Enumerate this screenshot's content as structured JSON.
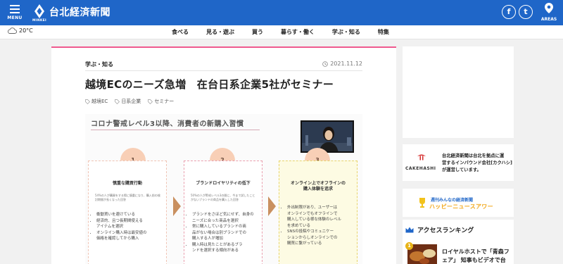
{
  "header": {
    "menu_label": "MENU",
    "site_title": "台北経済新聞",
    "logo_sub": "MINKEI",
    "social": [
      {
        "name": "facebook",
        "glyph": "f"
      },
      {
        "name": "twitter",
        "glyph": "t"
      }
    ],
    "areas_label": "AREAS"
  },
  "weather": {
    "temp": "20°C",
    "icon": "cloud-icon"
  },
  "nav": [
    "食べる",
    "見る・遊ぶ",
    "買う",
    "暮らす・働く",
    "学ぶ・知る",
    "特集"
  ],
  "article": {
    "category": "学ぶ・知る",
    "date": "2021.11.12",
    "title": "越境ECのニーズ急増　在台日系企業5社がセミナー",
    "tags": [
      "越境EC",
      "日系企業",
      "セミナー"
    ],
    "slide": {
      "title": "コロナ警戒レベル3以降、消費者の新購入習慣",
      "cards": [
        {
          "num": "1",
          "head": [
            "慎重な購買行動"
          ],
          "note": "54%の人が購買をする際に慎重になり、購入前の検討期間が長くなった回答",
          "items": [
            "衝動買いを避けている",
            "経済的、且つ長期間使える",
            "アイテムを選択",
            "オンライン購入時は最安値の",
            "価格を確認してから購入"
          ]
        },
        {
          "num": "2",
          "head": [
            "ブランドロイヤリティの低下"
          ],
          "note": "50%の人が警戒レベル3の間に、今まで試したことがないブランドの商品を購入した回答",
          "items": [
            "ブランドをさほど気にせず、自身の",
            "ニーズに合った商品を選択",
            "常に購入しているブランドの商",
            "品がない場合は別ブランドでの",
            "購入する人が増加",
            "購入時は見たことがあるブラ",
            "ンドを選択する傾向がある"
          ]
        },
        {
          "num": "3",
          "head": [
            "オンライン上でオフラインの",
            "購入体験を追求"
          ],
          "note": "",
          "items": [
            "外出制限があり、ユーザーは",
            "オンラインでもオフラインで",
            "購入している様な体験のレベル",
            "を求めている",
            "SNSの投稿やコミュニケー",
            "ションからしオンラインでの",
            "購買に繋がっている"
          ]
        }
      ]
    }
  },
  "sidebar": {
    "cakehashi": {
      "logo": "CAKEHASHI",
      "text": [
        "台北経済新聞は台北を拠点に運",
        "営するインバウンド会社[カクハシ]",
        "が運営しています。"
      ]
    },
    "happy_news": {
      "line1": "週刊みんなの経済新聞",
      "line2": "ハッピーニュースアワー"
    },
    "ranking": {
      "title": "アクセスランキング",
      "items": [
        {
          "rank": "1",
          "text": [
            "ロイヤルホストで「青森フ",
            "ェア」 知事もビデオで台"
          ]
        }
      ]
    }
  }
}
